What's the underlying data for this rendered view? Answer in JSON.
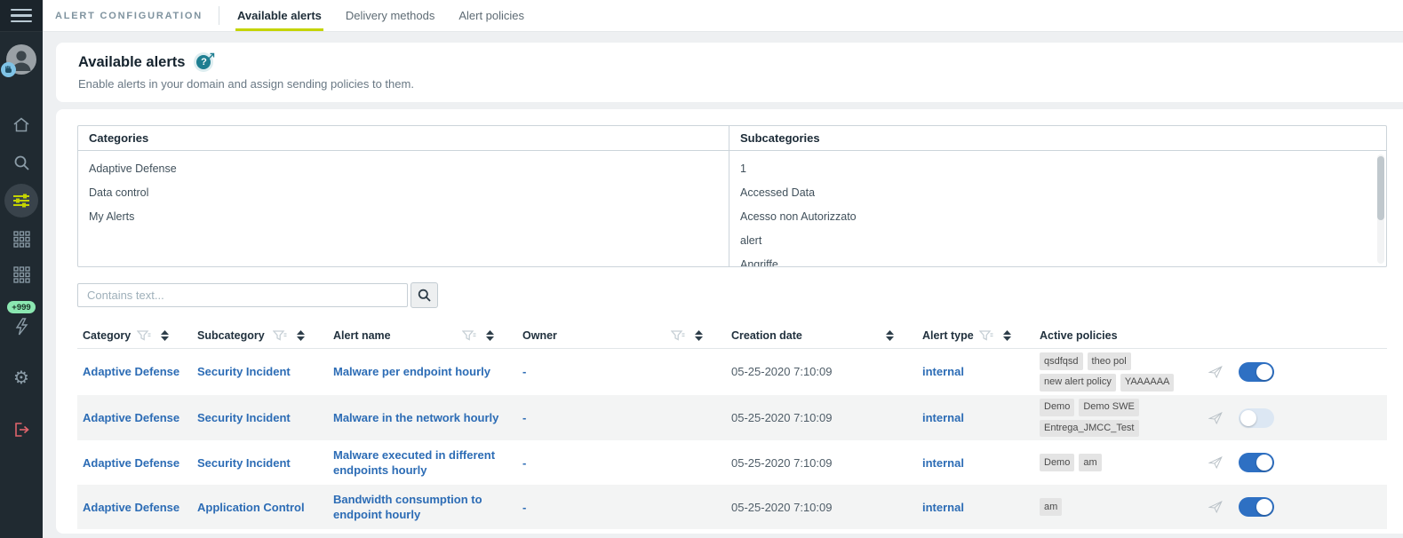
{
  "topbar": {
    "section_label": "ALERT CONFIGURATION",
    "tabs": [
      {
        "label": "Available alerts",
        "active": true
      },
      {
        "label": "Delivery methods",
        "active": false
      },
      {
        "label": "Alert policies",
        "active": false
      }
    ]
  },
  "sidebar": {
    "notification_badge": "+999",
    "icons": [
      "menu",
      "user-avatar",
      "home",
      "search",
      "alert-settings-active",
      "grid-apps",
      "grid-modules",
      "tasks-lightning",
      "settings-gear",
      "logout"
    ]
  },
  "page_header": {
    "title": "Available alerts",
    "subtitle": "Enable alerts in your domain and assign sending policies to them."
  },
  "panels": {
    "categories": {
      "title": "Categories",
      "items": [
        "Adaptive Defense",
        "Data control",
        "My Alerts"
      ]
    },
    "subcategories": {
      "title": "Subcategories",
      "items": [
        "1",
        "Accessed Data",
        "Acesso non Autorizzato",
        "alert",
        "Angriffe"
      ]
    }
  },
  "search": {
    "placeholder": "Contains text..."
  },
  "table": {
    "columns": [
      {
        "label": "Category",
        "filter": true,
        "sort": true
      },
      {
        "label": "Subcategory",
        "filter": true,
        "sort": true
      },
      {
        "label": "Alert name",
        "filter": true,
        "sort": true
      },
      {
        "label": "Owner",
        "filter": true,
        "sort": true
      },
      {
        "label": "Creation date",
        "filter": false,
        "sort": true
      },
      {
        "label": "Alert type",
        "filter": true,
        "sort": true
      },
      {
        "label": "Active policies",
        "filter": false,
        "sort": false
      }
    ],
    "rows": [
      {
        "category": "Adaptive Defense",
        "subcategory": "Security Incident",
        "alert_name": "Malware per endpoint hourly",
        "owner": "-",
        "creation_date": "05-25-2020 7:10:09",
        "alert_type": "internal",
        "policies": [
          "qsdfqsd",
          "theo pol",
          "new alert policy",
          "YAAAAAA"
        ],
        "enabled": true
      },
      {
        "category": "Adaptive Defense",
        "subcategory": "Security Incident",
        "alert_name": "Malware in the network hourly",
        "owner": "-",
        "creation_date": "05-25-2020 7:10:09",
        "alert_type": "internal",
        "policies": [
          "Demo",
          "Demo SWE",
          "Entrega_JMCC_Test"
        ],
        "enabled": false
      },
      {
        "category": "Adaptive Defense",
        "subcategory": "Security Incident",
        "alert_name": "Malware executed in different endpoints hourly",
        "owner": "-",
        "creation_date": "05-25-2020 7:10:09",
        "alert_type": "internal",
        "policies": [
          "Demo",
          "am"
        ],
        "enabled": true
      },
      {
        "category": "Adaptive Defense",
        "subcategory": "Application Control",
        "alert_name": "Bandwidth consumption to endpoint hourly",
        "owner": "-",
        "creation_date": "05-25-2020 7:10:09",
        "alert_type": "internal",
        "policies": [
          "am"
        ],
        "enabled": true
      }
    ]
  },
  "colors": {
    "accent_green": "#c4d400",
    "link_blue": "#2c6cb5",
    "toggle_on": "#2e70c3",
    "sidebar_bg": "#202a31",
    "badge_green": "#8be7b1",
    "teal_help": "#1e7e91",
    "logout_red": "#e0646c"
  }
}
